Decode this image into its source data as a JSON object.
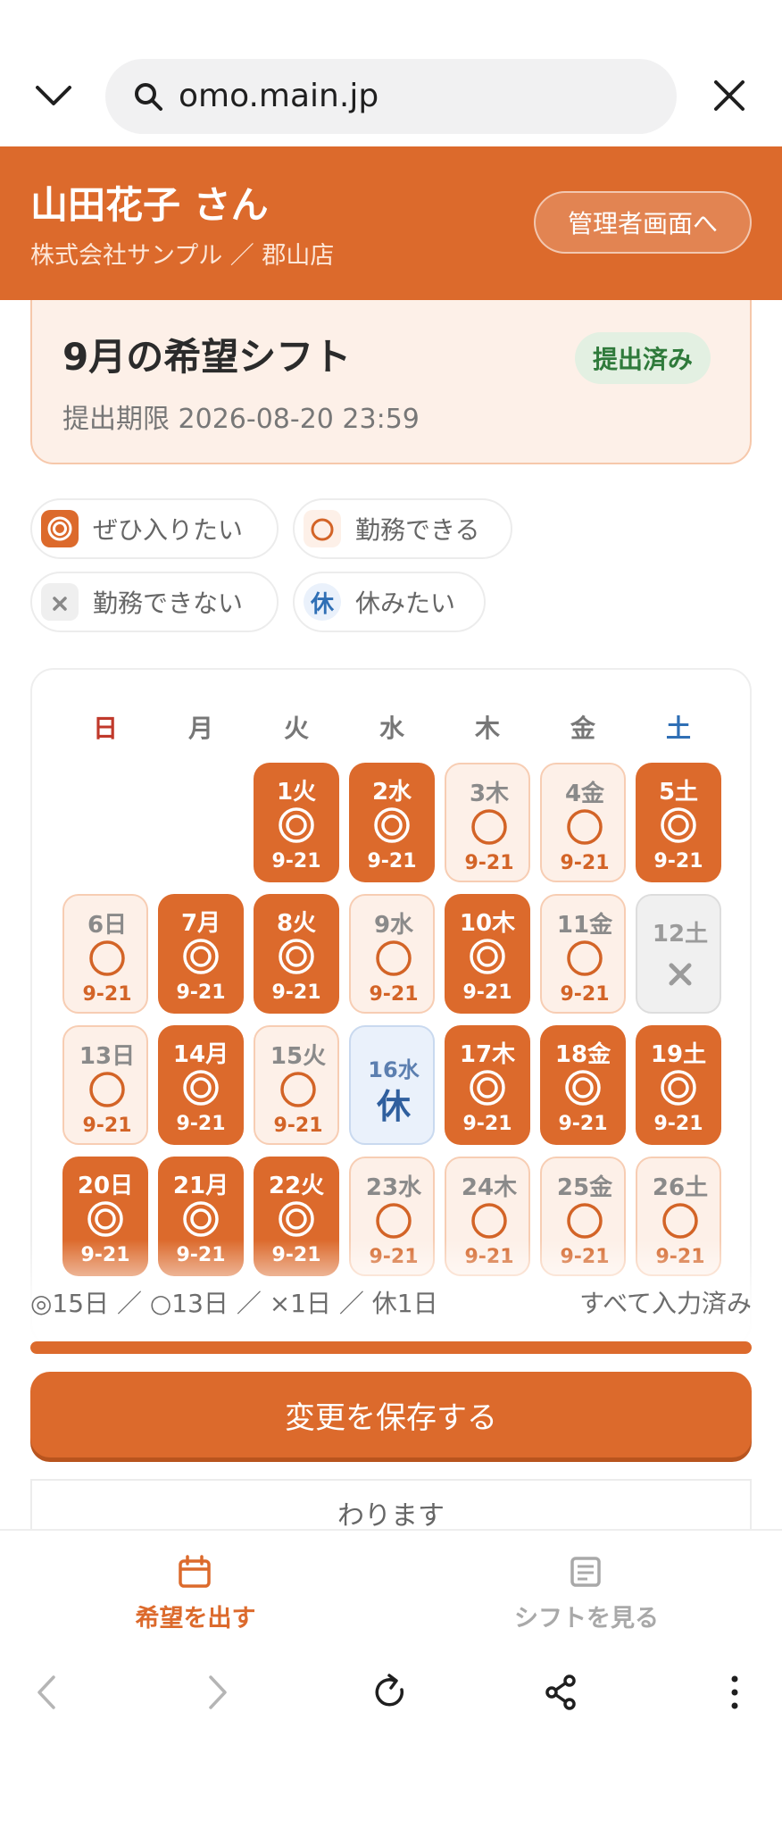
{
  "browser": {
    "url": "omo.main.jp"
  },
  "header": {
    "user_name": "山田花子 さん",
    "store": "株式会社サンプル ／ 郡山店",
    "admin_button": "管理者画面へ"
  },
  "shift_card": {
    "title": "9月の希望シフト",
    "deadline": "提出期限 2026-08-20 23:59",
    "status_badge": "提出済み"
  },
  "legend": [
    {
      "label": "ぜひ入りたい"
    },
    {
      "label": "勤務できる"
    },
    {
      "label": "勤務できない"
    },
    {
      "label": "休みたい",
      "icon_text": "休"
    }
  ],
  "calendar": {
    "weekdays": [
      "日",
      "月",
      "火",
      "水",
      "木",
      "金",
      "土"
    ],
    "days": [
      {
        "label": "1火",
        "status": "want",
        "time": "9-21"
      },
      {
        "label": "2水",
        "status": "want",
        "time": "9-21"
      },
      {
        "label": "3木",
        "status": "ok",
        "time": "9-21"
      },
      {
        "label": "4金",
        "status": "ok",
        "time": "9-21"
      },
      {
        "label": "5土",
        "status": "want",
        "time": "9-21"
      },
      {
        "label": "6日",
        "status": "ok",
        "time": "9-21"
      },
      {
        "label": "7月",
        "status": "want",
        "time": "9-21"
      },
      {
        "label": "8火",
        "status": "want",
        "time": "9-21"
      },
      {
        "label": "9水",
        "status": "ok",
        "time": "9-21"
      },
      {
        "label": "10木",
        "status": "want",
        "time": "9-21"
      },
      {
        "label": "11金",
        "status": "ok",
        "time": "9-21"
      },
      {
        "label": "12土",
        "status": "ng",
        "time": ""
      },
      {
        "label": "13日",
        "status": "ok",
        "time": "9-21"
      },
      {
        "label": "14月",
        "status": "want",
        "time": "9-21"
      },
      {
        "label": "15火",
        "status": "ok",
        "time": "9-21"
      },
      {
        "label": "16水",
        "status": "rest",
        "time": "",
        "rest_text": "休"
      },
      {
        "label": "17木",
        "status": "want",
        "time": "9-21"
      },
      {
        "label": "18金",
        "status": "want",
        "time": "9-21"
      },
      {
        "label": "19土",
        "status": "want",
        "time": "9-21"
      },
      {
        "label": "20日",
        "status": "want",
        "time": "9-21"
      },
      {
        "label": "21月",
        "status": "want",
        "time": "9-21"
      },
      {
        "label": "22火",
        "status": "want",
        "time": "9-21"
      },
      {
        "label": "23水",
        "status": "ok",
        "time": "9-21"
      },
      {
        "label": "24木",
        "status": "ok",
        "time": "9-21"
      },
      {
        "label": "25金",
        "status": "ok",
        "time": "9-21"
      },
      {
        "label": "26土",
        "status": "ok",
        "time": "9-21"
      }
    ]
  },
  "summary": {
    "counts": "◎15日 ／ ○13日 ／ ×1日 ／ 休1日",
    "status": "すべて入力済み",
    "progress": 1.0
  },
  "save_button": "変更を保存する",
  "notice": "わります",
  "tabs": [
    {
      "label": "希望を出す",
      "icon": "calendar-icon",
      "active": true
    },
    {
      "label": "シフトを見る",
      "icon": "document-icon",
      "active": false
    }
  ],
  "colors": {
    "accent": "#dc6a2c",
    "sunday": "#c0392b",
    "saturday": "#2f6fb5",
    "success": "#2f7a3b"
  }
}
